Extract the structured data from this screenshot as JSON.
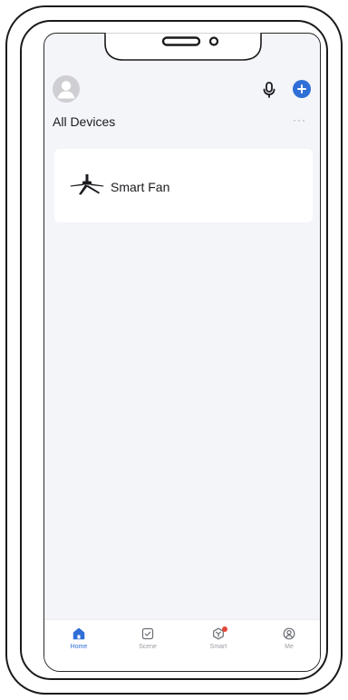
{
  "header": {
    "section_title": "All Devices",
    "more_label": "···"
  },
  "devices": [
    {
      "name": "Smart Fan",
      "icon": "ceiling-fan-icon"
    }
  ],
  "bottom_nav": {
    "items": [
      {
        "label": "Home",
        "icon": "home-icon",
        "active": true
      },
      {
        "label": "Scene",
        "icon": "scene-icon",
        "active": false
      },
      {
        "label": "Smart",
        "icon": "smart-icon",
        "active": false,
        "badge": true
      },
      {
        "label": "Me",
        "icon": "profile-icon",
        "active": false
      }
    ]
  },
  "colors": {
    "accent": "#2f6fd6",
    "badge": "#e5483b",
    "background": "#f4f5f9"
  }
}
